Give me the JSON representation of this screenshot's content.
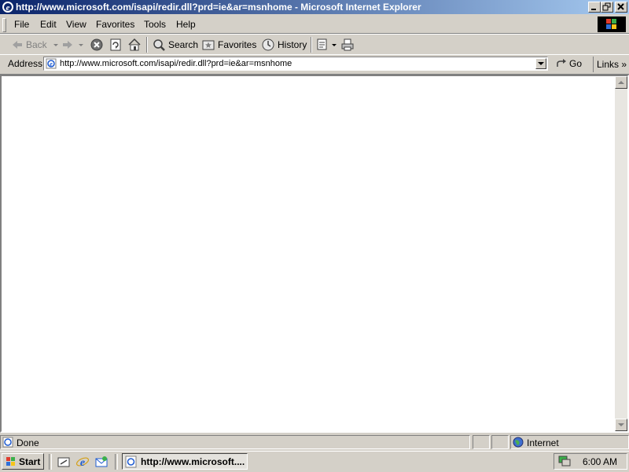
{
  "window": {
    "title": "http://www.microsoft.com/isapi/redir.dll?prd=ie&ar=msnhome - Microsoft Internet Explorer"
  },
  "menu": [
    "File",
    "Edit",
    "View",
    "Favorites",
    "Tools",
    "Help"
  ],
  "toolbar": {
    "back_label": "Back",
    "search_label": "Search",
    "favorites_label": "Favorites",
    "history_label": "History"
  },
  "address": {
    "label": "Address",
    "url": "http://www.microsoft.com/isapi/redir.dll?prd=ie&ar=msnhome",
    "go_label": "Go",
    "links_label": "Links"
  },
  "status": {
    "text": "Done",
    "zone": "Internet"
  },
  "taskbar": {
    "start_label": "Start",
    "task_label": "http://www.microsoft....",
    "clock": "6:00 AM"
  },
  "icons": {
    "ie": "ie-logo-icon",
    "back": "back-arrow-icon",
    "forward": "forward-arrow-icon",
    "stop": "stop-icon",
    "refresh": "refresh-icon",
    "home": "home-icon",
    "search": "search-icon",
    "favorites": "favorites-icon",
    "history": "history-icon",
    "mail": "mail-icon",
    "print": "print-icon"
  },
  "colors": {
    "title_active_start": "#0a246a",
    "title_active_end": "#a6caf0",
    "chrome": "#d4d0c8"
  }
}
